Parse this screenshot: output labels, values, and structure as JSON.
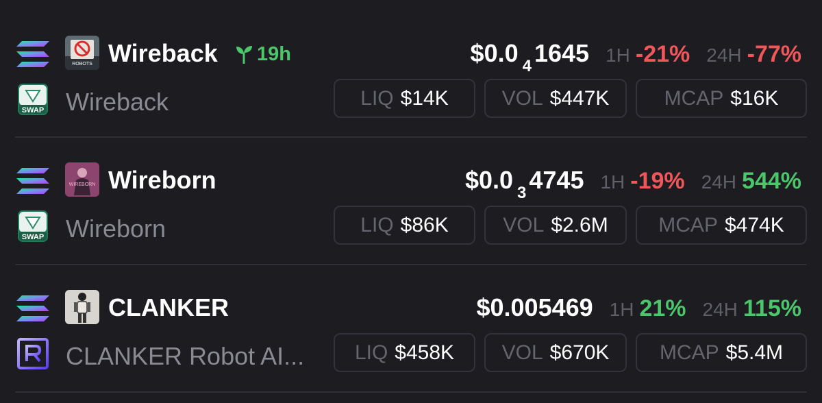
{
  "tokens": [
    {
      "symbol": "Wireback",
      "name": "Wireback",
      "age": "19h",
      "price_prefix": "$0.0",
      "price_zeros": "4",
      "price_digits": "1645",
      "h1_label": "1H",
      "h1_change": "-21%",
      "h24_label": "24H",
      "h24_change": "-77%",
      "liq_label": "LIQ",
      "liq": "$14K",
      "vol_label": "VOL",
      "vol": "$447K",
      "mcap_label": "MCAP",
      "mcap": "$16K",
      "chain_icon": "solana-icon",
      "dex_icon": "swap-icon",
      "dex_badge": "SWAP",
      "image_badge": "ROBOTS"
    },
    {
      "symbol": "Wireborn",
      "name": "Wireborn",
      "price_prefix": "$0.0",
      "price_zeros": "3",
      "price_digits": "4745",
      "h1_label": "1H",
      "h1_change": "-19%",
      "h24_label": "24H",
      "h24_change": "544%",
      "liq_label": "LIQ",
      "liq": "$86K",
      "vol_label": "VOL",
      "vol": "$2.6M",
      "mcap_label": "MCAP",
      "mcap": "$474K",
      "chain_icon": "solana-icon",
      "dex_icon": "swap-icon",
      "dex_badge": "SWAP",
      "image_badge": "WIREBORN"
    },
    {
      "symbol": "CLANKER",
      "name": "CLANKER Robot AI...",
      "price": "$0.005469",
      "h1_label": "1H",
      "h1_change": "21%",
      "h24_label": "24H",
      "h24_change": "115%",
      "liq_label": "LIQ",
      "liq": "$458K",
      "vol_label": "VOL",
      "vol": "$670K",
      "mcap_label": "MCAP",
      "mcap": "$5.4M",
      "chain_icon": "solana-icon",
      "dex_icon": "raydium-icon"
    }
  ],
  "colors": {
    "background": "#1c1c21",
    "positive": "#4cc66a",
    "negative": "#f0575a",
    "muted_text": "#8a8a93"
  }
}
